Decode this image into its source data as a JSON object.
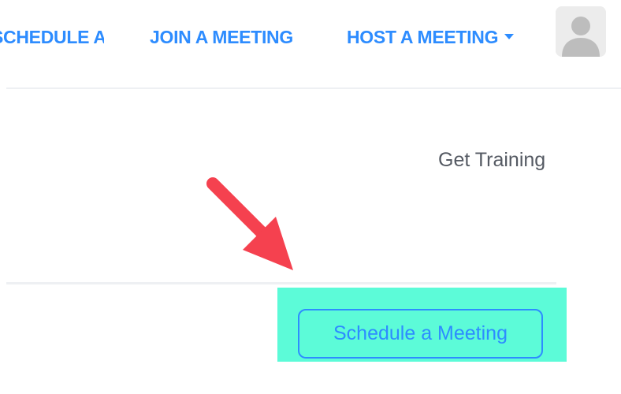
{
  "nav": {
    "items": [
      {
        "label": "SCHEDULE A MEETING"
      },
      {
        "label": "JOIN A MEETING"
      },
      {
        "label": "HOST A MEETING"
      }
    ],
    "accent_color": "#2d8cff"
  },
  "links": {
    "get_training": "Get Training"
  },
  "actions": {
    "schedule_label": "Schedule a Meeting"
  },
  "annotation": {
    "highlight_color": "#5cfbd8",
    "arrow_color": "#f5414f",
    "arrow_icon": "arrow-down-right-icon"
  },
  "user": {
    "avatar_icon": "user-avatar-icon"
  }
}
